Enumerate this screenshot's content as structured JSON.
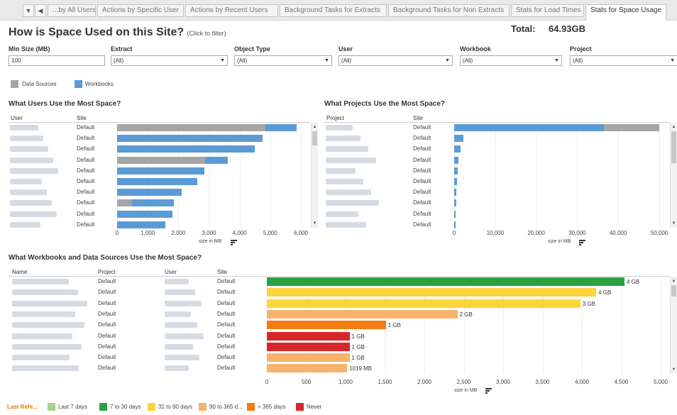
{
  "tabs": {
    "items": [
      "...by All Users",
      "Actions by Specific User",
      "Actions by Recent Users",
      "Background Tasks for Extracts",
      "Background Tasks for Non Extracts",
      "Stats for Load Times",
      "Stats for Space Usage"
    ],
    "active": "Stats for Space Usage"
  },
  "header": {
    "title": "How is Space Used on this Site?",
    "subtitle": "(Click to filter)",
    "total_label": "Total:",
    "total_value": "64.93GB"
  },
  "filters": [
    {
      "label": "Min Size (MB)",
      "value": "100",
      "dropdown": false
    },
    {
      "label": "Extract",
      "value": "(All)",
      "dropdown": true
    },
    {
      "label": "Object Type",
      "value": "(All)",
      "dropdown": true
    },
    {
      "label": "User",
      "value": "(All)",
      "dropdown": true
    },
    {
      "label": "Workbook",
      "value": "(All)",
      "dropdown": true
    },
    {
      "label": "Project",
      "value": "(All)",
      "dropdown": true
    }
  ],
  "type_legend": [
    {
      "label": "Data Sources",
      "color": "#a5a5a5"
    },
    {
      "label": "Workbooks",
      "color": "#5b9bd5"
    }
  ],
  "users_chart": {
    "title": "What Users Use the Most Space?",
    "col_user": "User",
    "col_site": "Site",
    "axis_title": "size in MB",
    "ticks": [
      "0",
      "1,000",
      "2,000",
      "3,000",
      "4,000",
      "5,000",
      "6,000"
    ],
    "rows": [
      {
        "site": "Default"
      },
      {
        "site": "Default"
      },
      {
        "site": "Default"
      },
      {
        "site": "Default"
      },
      {
        "site": "Default"
      },
      {
        "site": "Default"
      },
      {
        "site": "Default"
      },
      {
        "site": "Default"
      },
      {
        "site": "Default"
      },
      {
        "site": "Default"
      }
    ]
  },
  "projects_chart": {
    "title": "What Projects Use the Most Space?",
    "col_project": "Project",
    "col_site": "Site",
    "axis_title": "size in MB",
    "ticks": [
      "0",
      "10,000",
      "20,000",
      "30,000",
      "40,000",
      "50,000"
    ],
    "rows": [
      {
        "site": "Default"
      },
      {
        "site": "Default"
      },
      {
        "site": "Default"
      },
      {
        "site": "Default"
      },
      {
        "site": "Default"
      },
      {
        "site": "Default"
      },
      {
        "site": "Default"
      },
      {
        "site": "Default"
      },
      {
        "site": "Default"
      },
      {
        "site": "Default"
      }
    ]
  },
  "workbooks_chart": {
    "title": "What Workbooks and Data Sources Use the Most Space?",
    "col_name": "Name",
    "col_project": "Project",
    "col_user": "User",
    "col_site": "Site",
    "axis_title": "size in MB",
    "ticks": [
      "0",
      "500",
      "1,000",
      "1,500",
      "2,000",
      "2,500",
      "3,000",
      "3,500",
      "4,000",
      "4,500",
      "5,000"
    ],
    "rows": [
      {
        "project": "Default",
        "site": "Default",
        "label": "4 GB"
      },
      {
        "project": "Default",
        "site": "Default",
        "label": "4 GB"
      },
      {
        "project": "Default",
        "site": "Default",
        "label": "3 GB"
      },
      {
        "project": "Default",
        "site": "Default",
        "label": "2 GB"
      },
      {
        "project": "Default",
        "site": "Default",
        "label": "1 GB"
      },
      {
        "project": "Default",
        "site": "Default",
        "label": "1 GB"
      },
      {
        "project": "Default",
        "site": "Default",
        "label": "1 GB"
      },
      {
        "project": "Default",
        "site": "Default",
        "label": "1 GB"
      },
      {
        "project": "Default",
        "site": "Default",
        "label": "1019 MB"
      }
    ]
  },
  "last_referenced_legend": {
    "title": "Last Refe...",
    "items": [
      {
        "label": "Last 7 days",
        "color": "#a6d38a"
      },
      {
        "label": "7 to 30 days",
        "color": "#2ca043"
      },
      {
        "label": "31 to 90 days",
        "color": "#fcd43c"
      },
      {
        "label": "90 to 365 d...",
        "color": "#f7b26e"
      },
      {
        "label": "> 365 days",
        "color": "#f37b10"
      },
      {
        "label": "Never",
        "color": "#d7262a"
      }
    ]
  },
  "chart_data": [
    {
      "type": "bar",
      "title": "What Users Use the Most Space?",
      "xlabel": "size in MB",
      "xlim": [
        0,
        6300
      ],
      "series": [
        {
          "name": "Data Sources",
          "values": [
            4850,
            0,
            0,
            2880,
            0,
            0,
            0,
            480,
            0,
            0
          ]
        },
        {
          "name": "Workbooks",
          "values": [
            1000,
            4750,
            4500,
            740,
            2840,
            2610,
            2100,
            1370,
            1800,
            1580
          ]
        }
      ]
    },
    {
      "type": "bar",
      "title": "What Projects Use the Most Space?",
      "xlabel": "size in MB",
      "xlim": [
        0,
        51500
      ],
      "series": [
        {
          "name": "Workbooks",
          "values": [
            36500,
            2200,
            1500,
            1100,
            900,
            700,
            600,
            500,
            400,
            300
          ]
        },
        {
          "name": "Data Sources",
          "values": [
            13500,
            0,
            0,
            0,
            0,
            0,
            0,
            0,
            0,
            0
          ]
        }
      ]
    },
    {
      "type": "bar",
      "title": "What Workbooks and Data Sources Use the Most Space?",
      "xlabel": "size in MB",
      "xlim": [
        0,
        5150
      ],
      "values": [
        4540,
        4180,
        3980,
        2420,
        1510,
        1050,
        1050,
        1050,
        1019
      ],
      "colors": [
        "#2ca043",
        "#fcd43c",
        "#fcd43c",
        "#f7b26e",
        "#f37b10",
        "#d7262a",
        "#d7262a",
        "#f7b26e",
        "#f7b26e"
      ]
    }
  ]
}
